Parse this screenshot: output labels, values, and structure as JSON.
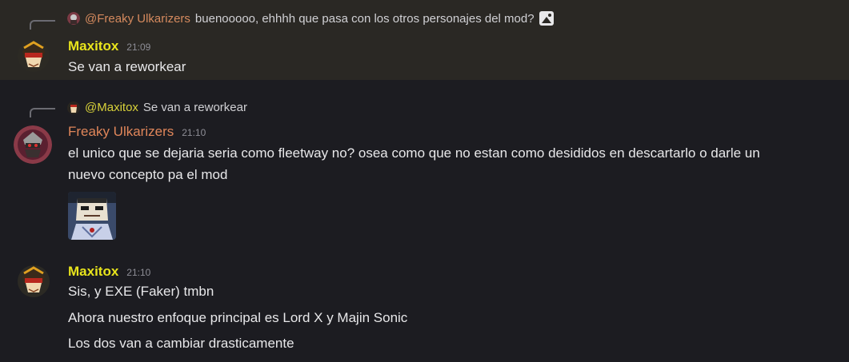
{
  "messages": [
    {
      "reply": {
        "author": "@Freaky Ulkarizers",
        "text": "buenooooo, ehhhh que pasa con los otros personajes del mod?",
        "icon": "image-icon"
      },
      "author": "Maxitox",
      "time": "21:09",
      "lines": [
        "Se van a reworkear"
      ],
      "name_color": "#e8e41c"
    },
    {
      "reply": {
        "author": "@Maxitox",
        "text": "Se van a reworkear"
      },
      "author": "Freaky Ulkarizers",
      "time": "21:10",
      "lines": [
        "el unico que se dejaria seria como fleetway no? osea como que no estan como desididos en descartarlo o darle un",
        "nuevo concepto pa el mod"
      ],
      "name_color": "#e0865a"
    },
    {
      "author": "Maxitox",
      "time": "21:10",
      "lines": [
        "Sis, y EXE (Faker) tmbn",
        "Ahora nuestro enfoque principal es Lord X y Majin Sonic",
        "Los dos van a cambiar drasticamente"
      ],
      "name_color": "#e8e41c"
    }
  ]
}
